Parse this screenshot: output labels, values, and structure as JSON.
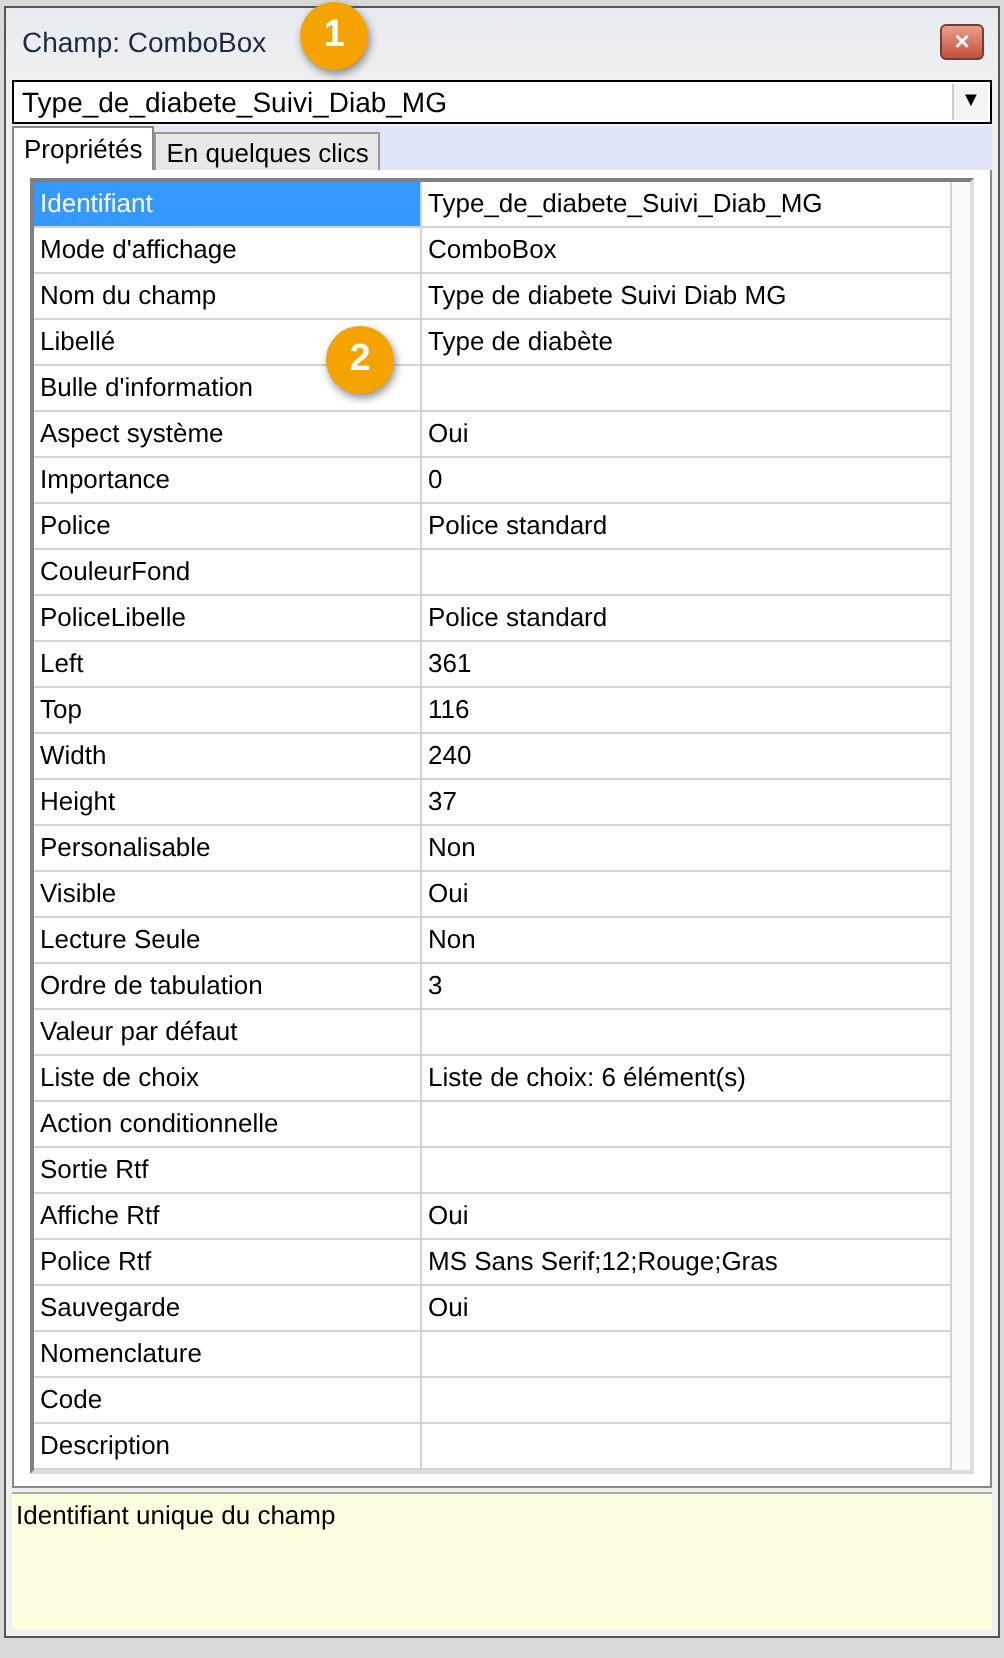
{
  "window": {
    "title": "Champ: ComboBox",
    "close_label": "×"
  },
  "field_selector": {
    "value": "Type_de_diabete_Suivi_Diab_MG",
    "arrow": "▼"
  },
  "tabs": [
    {
      "label": "Propriétés",
      "selected": true
    },
    {
      "label": "En quelques clics",
      "selected": false
    }
  ],
  "properties": [
    {
      "name": "Identifiant",
      "value": "Type_de_diabete_Suivi_Diab_MG",
      "selected": true
    },
    {
      "name": "Mode d'affichage",
      "value": "ComboBox",
      "selected": false
    },
    {
      "name": "Nom du champ",
      "value": "Type de diabete Suivi Diab MG",
      "selected": false
    },
    {
      "name": "Libellé",
      "value": "Type de diabète",
      "selected": false
    },
    {
      "name": "Bulle d'information",
      "selected": false
    },
    {
      "name": "Aspect système",
      "value": "Oui",
      "selected": false
    },
    {
      "name": "Importance",
      "value": "0",
      "selected": false
    },
    {
      "name": "Police",
      "value": "Police standard",
      "selected": false
    },
    {
      "name": "CouleurFond",
      "selected": false
    },
    {
      "name": "PoliceLibelle",
      "value": "Police standard",
      "selected": false
    },
    {
      "name": "Left",
      "value": "361",
      "selected": false
    },
    {
      "name": "Top",
      "value": "116",
      "selected": false
    },
    {
      "name": "Width",
      "value": "240",
      "selected": false
    },
    {
      "name": "Height",
      "value": "37",
      "selected": false
    },
    {
      "name": "Personalisable",
      "value": "Non",
      "selected": false
    },
    {
      "name": "Visible",
      "value": "Oui",
      "selected": false
    },
    {
      "name": "Lecture Seule",
      "value": "Non",
      "selected": false
    },
    {
      "name": "Ordre de tabulation",
      "value": "3",
      "selected": false
    },
    {
      "name": "Valeur par défaut",
      "selected": false
    },
    {
      "name": "Liste de choix",
      "value": "Liste de choix: 6 élément(s)",
      "selected": false
    },
    {
      "name": "Action conditionnelle",
      "selected": false
    },
    {
      "name": "Sortie Rtf",
      "selected": false
    },
    {
      "name": "Affiche Rtf",
      "value": "Oui",
      "selected": false
    },
    {
      "name": "Police Rtf",
      "value": "MS Sans Serif;12;Rouge;Gras",
      "selected": false
    },
    {
      "name": "Sauvegarde",
      "value": "Oui",
      "selected": false
    },
    {
      "name": "Nomenclature",
      "selected": false
    },
    {
      "name": "Code",
      "selected": false
    },
    {
      "name": "Description",
      "selected": false
    }
  ],
  "description": "Identifiant unique du champ",
  "callouts": [
    {
      "label": "1"
    },
    {
      "label": "2"
    }
  ]
}
